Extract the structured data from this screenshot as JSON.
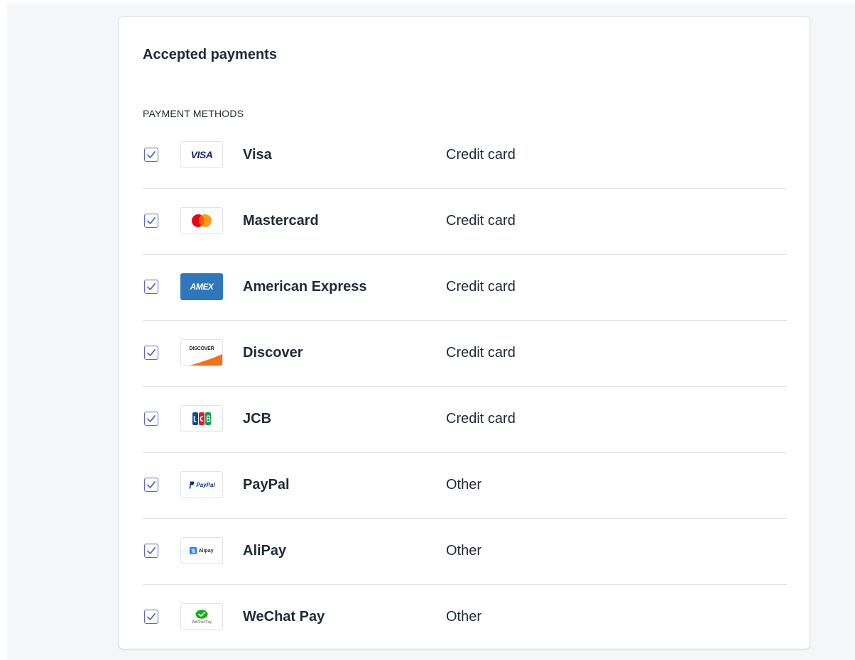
{
  "card": {
    "title": "Accepted payments",
    "section_label": "PAYMENT METHODS"
  },
  "methods": [
    {
      "name": "Visa",
      "type": "Credit card",
      "checked": true,
      "logo_icon": "visa-logo",
      "logo_text": "VISA"
    },
    {
      "name": "Mastercard",
      "type": "Credit card",
      "checked": true,
      "logo_icon": "mastercard-logo"
    },
    {
      "name": "American Express",
      "type": "Credit card",
      "checked": true,
      "logo_icon": "amex-logo",
      "logo_text": "AMEX"
    },
    {
      "name": "Discover",
      "type": "Credit card",
      "checked": true,
      "logo_icon": "discover-logo",
      "logo_text": "DISCOVER"
    },
    {
      "name": "JCB",
      "type": "Credit card",
      "checked": true,
      "logo_icon": "jcb-logo"
    },
    {
      "name": "PayPal",
      "type": "Other",
      "checked": true,
      "logo_icon": "paypal-logo",
      "logo_text": "PayPal"
    },
    {
      "name": "AliPay",
      "type": "Other",
      "checked": true,
      "logo_icon": "alipay-logo",
      "logo_text": "Alipay"
    },
    {
      "name": "WeChat Pay",
      "type": "Other",
      "checked": true,
      "logo_icon": "wechat-pay-logo",
      "logo_text": "WeChat Pay"
    }
  ],
  "colors": {
    "accent": "#5c6ac4",
    "divider": "#dfe3e8",
    "page_background": "#f4f6f8",
    "text": "#212b36"
  }
}
